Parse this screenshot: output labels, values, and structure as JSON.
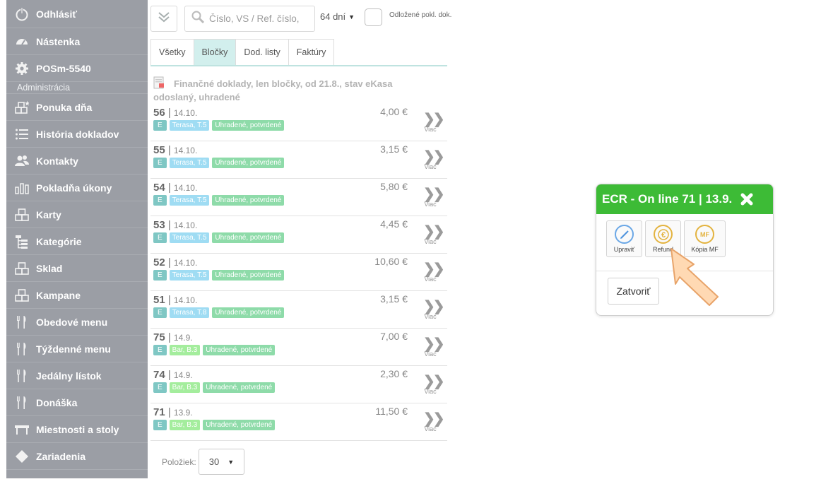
{
  "sidebar": {
    "logout": "Odhlásiť",
    "items_top": [
      {
        "label": "Nástenka",
        "icon": "gauge-icon"
      },
      {
        "label": "POSm-5540",
        "icon": "gear-icon"
      }
    ],
    "section": "Administrácia",
    "items": [
      {
        "label": "Ponuka dňa",
        "icon": "boxes-star-icon"
      },
      {
        "label": "História dokladov",
        "icon": "list-icon"
      },
      {
        "label": "Kontakty",
        "icon": "users-icon"
      },
      {
        "label": "Pokladňa úkony",
        "icon": "bars-icon"
      },
      {
        "label": "Karty",
        "icon": "boxes-icon"
      },
      {
        "label": "Kategórie",
        "icon": "tree-icon"
      },
      {
        "label": "Sklad",
        "icon": "boxes-icon"
      },
      {
        "label": "Kampane",
        "icon": "boxes-icon"
      },
      {
        "label": "Obedové menu",
        "icon": "cutlery-icon"
      },
      {
        "label": "Týždenné menu",
        "icon": "cutlery-icon"
      },
      {
        "label": "Jedálny lístok",
        "icon": "cutlery-icon"
      },
      {
        "label": "Donáška",
        "icon": "cutlery-icon"
      },
      {
        "label": "Miestnosti a stoly",
        "icon": "table-icon"
      },
      {
        "label": "Zariadenia",
        "icon": "diamond-icon"
      }
    ]
  },
  "toolbar": {
    "search_placeholder": "Číslo, VS / Ref. číslo,",
    "days": "64 dní",
    "checkbox_label": "Odložené pokl. dok."
  },
  "tabs": [
    {
      "label": "Všetky",
      "active": false
    },
    {
      "label": "Bločky",
      "active": true
    },
    {
      "label": "Dod. listy",
      "active": false
    },
    {
      "label": "Faktúry",
      "active": false
    }
  ],
  "info": "Finančné doklady, len bločky, od 21.8., stav eKasa odoslaný, uhradené",
  "receipts": [
    {
      "num": "56",
      "date": "14.10.",
      "amount": "4,00 €",
      "tag_e": "E",
      "place": "Terasa, T.5",
      "place_type": "t",
      "status": "Uhradené, potvrdené"
    },
    {
      "num": "55",
      "date": "14.10.",
      "amount": "3,15 €",
      "tag_e": "E",
      "place": "Terasa, T.5",
      "place_type": "t",
      "status": "Uhradené, potvrdené"
    },
    {
      "num": "54",
      "date": "14.10.",
      "amount": "5,80 €",
      "tag_e": "E",
      "place": "Terasa, T.5",
      "place_type": "t",
      "status": "Uhradené, potvrdené"
    },
    {
      "num": "53",
      "date": "14.10.",
      "amount": "4,45 €",
      "tag_e": "E",
      "place": "Terasa, T.5",
      "place_type": "t",
      "status": "Uhradené, potvrdené"
    },
    {
      "num": "52",
      "date": "14.10.",
      "amount": "10,60 €",
      "tag_e": "E",
      "place": "Terasa, T.5",
      "place_type": "t",
      "status": "Uhradené, potvrdené"
    },
    {
      "num": "51",
      "date": "14.10.",
      "amount": "3,15 €",
      "tag_e": "E",
      "place": "Terasa, T.8",
      "place_type": "t",
      "status": "Uhradené, potvrdené"
    },
    {
      "num": "75",
      "date": "14.9.",
      "amount": "7,00 €",
      "tag_e": "E",
      "place": "Bar, B.3",
      "place_type": "b",
      "status": "Uhradené, potvrdené"
    },
    {
      "num": "74",
      "date": "14.9.",
      "amount": "2,30 €",
      "tag_e": "E",
      "place": "Bar, B.3",
      "place_type": "b",
      "status": "Uhradené, potvrdené"
    },
    {
      "num": "71",
      "date": "13.9.",
      "amount": "11,50 €",
      "tag_e": "E",
      "place": "Bar, B.3",
      "place_type": "b",
      "status": "Uhradené, potvrdené"
    }
  ],
  "more_label": "Viac",
  "pager": {
    "label": "Položiek:",
    "value": "30"
  },
  "modal": {
    "title": "ECR - On line 71 | 13.9.",
    "actions": {
      "edit": "Upraviť",
      "refund": "Refund",
      "copy": "Kópia MF",
      "copy_icon_text": "MF"
    },
    "close": "Zatvoriť"
  },
  "colors": {
    "header_green": "#3dbb36",
    "sidebar": "#9b9ea5",
    "tab_active": "#d2efed"
  }
}
